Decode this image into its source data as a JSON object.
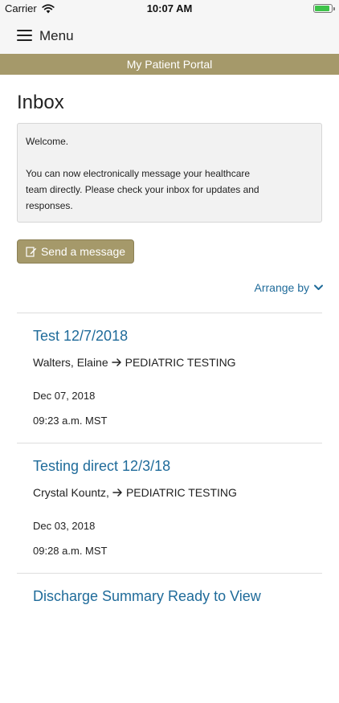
{
  "status_bar": {
    "carrier": "Carrier",
    "time": "10:07 AM"
  },
  "header": {
    "menu_label": "Menu",
    "portal_title": "My Patient Portal"
  },
  "main": {
    "title": "Inbox",
    "welcome": {
      "greeting": "Welcome.",
      "body": "You can now electronically message your healthcare team directly. Please check your inbox for updates and responses."
    },
    "send_button": "Send a message",
    "arrange_by": "Arrange by"
  },
  "messages": [
    {
      "subject": "Test 12/7/2018",
      "from": "Walters, Elaine",
      "to": "PEDIATRIC TESTING",
      "date": "Dec 07, 2018",
      "time": "09:23 a.m. MST"
    },
    {
      "subject": "Testing direct 12/3/18",
      "from": "Crystal Kountz,",
      "to": "PEDIATRIC TESTING",
      "date": "Dec 03, 2018",
      "time": "09:28 a.m. MST"
    },
    {
      "subject": "Discharge Summary Ready to View"
    }
  ],
  "colors": {
    "accent_gold": "#a5996a",
    "link_blue": "#1f6b9a",
    "battery_green": "#3ec34a"
  }
}
